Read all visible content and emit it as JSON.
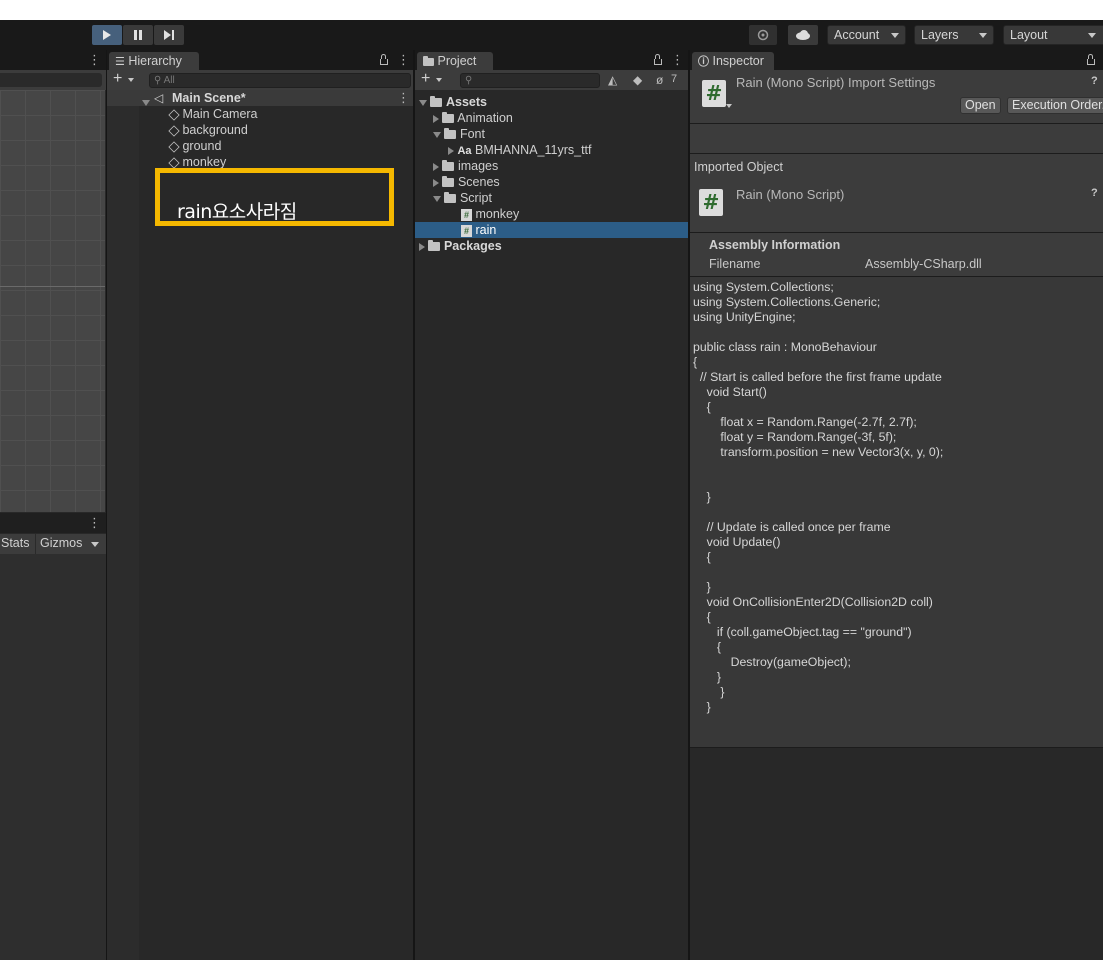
{
  "toolbar": {
    "play_icon": "play-icon",
    "pause_icon": "pause-icon",
    "step_icon": "step-icon",
    "account_label": "Account",
    "layers_label": "Layers",
    "layout_label": "Layout"
  },
  "scene_panel": {
    "stats_label": "Stats",
    "gizmos_label": "Gizmos"
  },
  "hierarchy": {
    "tab_label": "Hierarchy",
    "search_placeholder": "All",
    "scene_name": "Main Scene*",
    "items": [
      "Main Camera",
      "background",
      "ground",
      "monkey"
    ],
    "annotation_text": "rain요소사라짐"
  },
  "project": {
    "tab_label": "Project",
    "hidden_count": "7",
    "tree": {
      "assets": "Assets",
      "animation": "Animation",
      "font": "Font",
      "font_file_prefix": "Aa",
      "font_file": "BMHANNA_11yrs_ttf",
      "images": "images",
      "scenes": "Scenes",
      "script": "Script",
      "script_monkey": "monkey",
      "script_rain": "rain",
      "packages": "Packages"
    }
  },
  "inspector": {
    "tab_label": "Inspector",
    "header_title": "Rain (Mono Script) Import Settings",
    "open_button": "Open",
    "execution_order_button": "Execution Order...",
    "imported_object_label": "Imported Object",
    "object_title": "Rain (Mono Script)",
    "assembly_info_label": "Assembly Information",
    "filename_label": "Filename",
    "filename_value": "Assembly-CSharp.dll",
    "code": "using System.Collections;\nusing System.Collections.Generic;\nusing UnityEngine;\n\npublic class rain : MonoBehaviour\n{\n  // Start is called before the first frame update\n    void Start()\n    {\n        float x = Random.Range(-2.7f, 2.7f);\n        float y = Random.Range(-3f, 5f);\n        transform.position = new Vector3(x, y, 0);\n\n\n    }\n\n    // Update is called once per frame\n    void Update()\n    {\n\n    }\n    void OnCollisionEnter2D(Collision2D coll)\n    {\n       if (coll.gameObject.tag == \"ground\")\n       {\n           Destroy(gameObject);\n       }\n        }\n    }"
  },
  "colors": {
    "accent_play": "#46607c",
    "annotation_border": "#f5b800",
    "selected_row": "#2c5d87"
  }
}
